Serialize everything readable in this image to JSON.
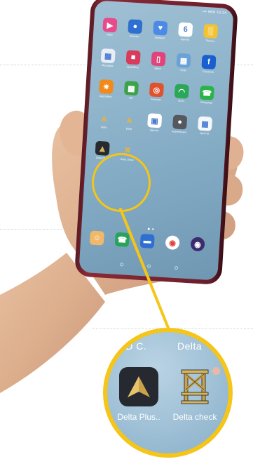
{
  "status_bar": {
    "text": "••• 96% 15:24"
  },
  "home_screen": {
    "row1": [
      {
        "label": "Video",
        "icon": "play-icon",
        "color": "#e94a8a"
      },
      {
        "label": "Browser",
        "icon": "globe-icon",
        "color": "#2f6fd1"
      },
      {
        "label": "Assistant",
        "icon": "heart-icon",
        "color": "#4b8be6"
      },
      {
        "label": "Agenda",
        "icon": "calendar-icon",
        "color": "#ffffff",
        "badge": "6"
      },
      {
        "label": "Themes",
        "icon": "brush-icon",
        "color": "#f2c230"
      }
    ],
    "row2": [
      {
        "label": "Messages",
        "icon": "tiles-icon",
        "color": "#e8eef4"
      },
      {
        "label": "AppGallery",
        "icon": "bag-icon",
        "color": "#d83b5b"
      },
      {
        "label": "Mirror",
        "icon": "mirror-icon",
        "color": "#e0447a"
      },
      {
        "label": "Tools",
        "icon": "folder-icon",
        "color": "#6aa2d8"
      },
      {
        "label": "Facebook",
        "icon": "facebook-icon",
        "color": "#1a5fd0"
      }
    ],
    "row3": [
      {
        "label": "AppGallery",
        "icon": "sun-icon",
        "color": "#f28a1a"
      },
      {
        "label": "QR",
        "icon": "qr-icon",
        "color": "#3da34b"
      },
      {
        "label": "Recorder",
        "icon": "recorder-icon",
        "color": "#e0522e"
      },
      {
        "label": "Wi-Fi",
        "icon": "wifi-icon",
        "color": "#2aa757"
      },
      {
        "label": "WhatsApp",
        "icon": "whatsapp-icon",
        "color": "#29b34a"
      }
    ],
    "row4": [
      {
        "label": "Delta",
        "icon": "delta-icon",
        "color": "transparent"
      },
      {
        "label": "Delta",
        "icon": "delta-icon",
        "color": "transparent"
      },
      {
        "label": "Agenda",
        "icon": "agenda-icon",
        "color": "#ffffff"
      },
      {
        "label": "Authenticator",
        "icon": "auth-icon",
        "color": "#55585e"
      },
      {
        "label": "Sport ID",
        "icon": "sport-icon",
        "color": "#f4f7fa"
      }
    ],
    "row5": [
      {
        "label": "Delta Plus",
        "icon": "delta-plus-icon",
        "color": "#262a30"
      },
      {
        "label": "Delta check",
        "icon": "delta-check-icon",
        "color": "transparent"
      }
    ],
    "dock": [
      {
        "icon": "contacts-icon",
        "color": "#f1b86a"
      },
      {
        "icon": "phone-icon",
        "color": "#27a45a"
      },
      {
        "icon": "messages-icon",
        "color": "#2f6fd1"
      },
      {
        "icon": "chrome-icon",
        "color": "#ffffff"
      },
      {
        "icon": "camera-icon",
        "color": "#3b2c6e"
      }
    ]
  },
  "zoom": {
    "top_left_label": "PID C.",
    "top_right_label": "Delta",
    "apps": [
      {
        "label": "Delta Plus..",
        "icon": "delta-plus-icon"
      },
      {
        "label": "Delta check",
        "icon": "delta-check-icon"
      }
    ]
  },
  "colors": {
    "highlight": "#f5c518",
    "delta_gold": "#d6b35a"
  }
}
